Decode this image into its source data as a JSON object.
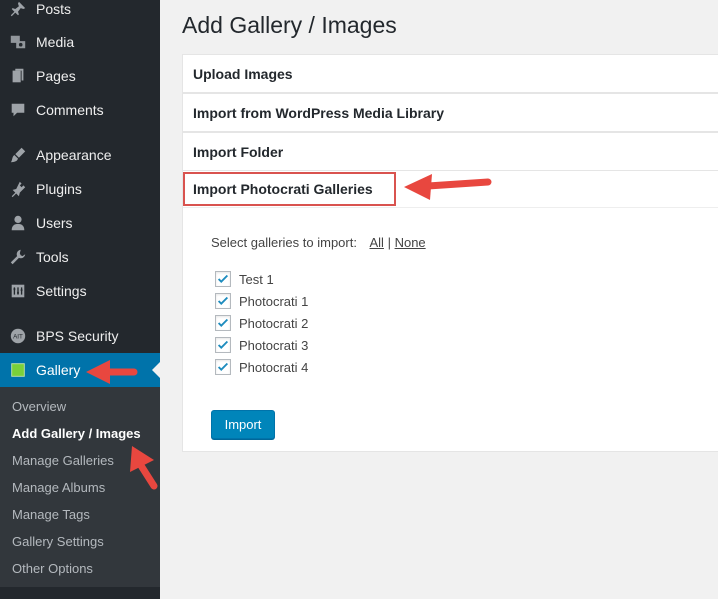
{
  "sidebar": {
    "items": [
      {
        "label": "Posts",
        "icon": "pushpin-icon"
      },
      {
        "label": "Media",
        "icon": "media-icon"
      },
      {
        "label": "Pages",
        "icon": "pages-icon"
      },
      {
        "label": "Comments",
        "icon": "comment-icon"
      },
      {
        "label": "Appearance",
        "icon": "paintbrush-icon"
      },
      {
        "label": "Plugins",
        "icon": "plugin-icon"
      },
      {
        "label": "Users",
        "icon": "user-icon"
      },
      {
        "label": "Tools",
        "icon": "wrench-icon"
      },
      {
        "label": "Settings",
        "icon": "settings-icon"
      },
      {
        "label": "BPS Security",
        "icon": "bps-icon"
      },
      {
        "label": "Gallery",
        "icon": "gallery-icon"
      }
    ],
    "submenu": [
      "Overview",
      "Add Gallery / Images",
      "Manage Galleries",
      "Manage Albums",
      "Manage Tags",
      "Gallery Settings",
      "Other Options"
    ]
  },
  "main": {
    "title": "Add Gallery / Images",
    "sections": [
      "Upload Images",
      "Import from WordPress Media Library",
      "Import Folder",
      "Import Photocrati Galleries"
    ],
    "select_text": "Select galleries to import:",
    "all_link": "All",
    "separator": "|",
    "none_link": "None",
    "galleries": [
      "Test 1",
      "Photocrati 1",
      "Photocrati 2",
      "Photocrati 3",
      "Photocrati 4"
    ],
    "import_button": "Import"
  },
  "colors": {
    "sidebar_bg": "#23282d",
    "active_bg": "#0073aa",
    "gallery_icon": "#7ad03a",
    "annotation_red": "#e8473f"
  }
}
